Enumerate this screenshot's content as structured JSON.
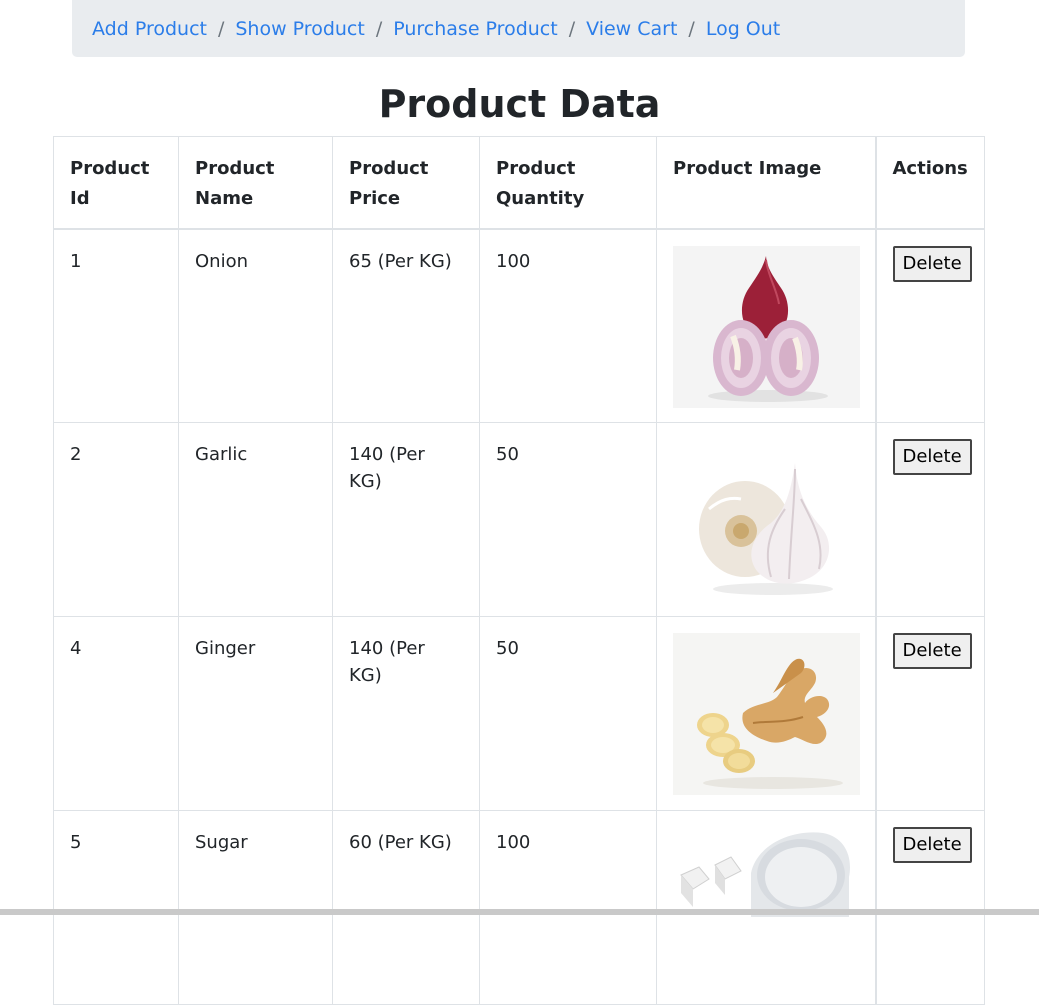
{
  "nav": {
    "items": [
      {
        "label": "Add Product"
      },
      {
        "label": "Show Product"
      },
      {
        "label": "Purchase Product"
      },
      {
        "label": "View Cart"
      },
      {
        "label": "Log Out"
      }
    ],
    "separator": "/"
  },
  "page": {
    "title": "Product Data"
  },
  "table": {
    "headers": {
      "id": "Product Id",
      "name": "Product Name",
      "price": "Product Price",
      "quantity": "Product Quantity",
      "image": "Product Image",
      "actions": "Actions"
    },
    "rows": [
      {
        "id": "1",
        "name": "Onion",
        "price": "65 (Per KG)",
        "quantity": "100",
        "image": "onion-image",
        "action": "Delete"
      },
      {
        "id": "2",
        "name": "Garlic",
        "price": "140 (Per KG)",
        "quantity": "50",
        "image": "garlic-image",
        "action": "Delete"
      },
      {
        "id": "4",
        "name": "Ginger",
        "price": "140 (Per KG)",
        "quantity": "50",
        "image": "ginger-image",
        "action": "Delete"
      },
      {
        "id": "5",
        "name": "Sugar",
        "price": "60 (Per KG)",
        "quantity": "100",
        "image": "sugar-image",
        "action": "Delete"
      }
    ]
  },
  "colors": {
    "link": "#2b7de9",
    "breadcrumb_bg": "#e9ecef",
    "border": "#dee2e6"
  }
}
